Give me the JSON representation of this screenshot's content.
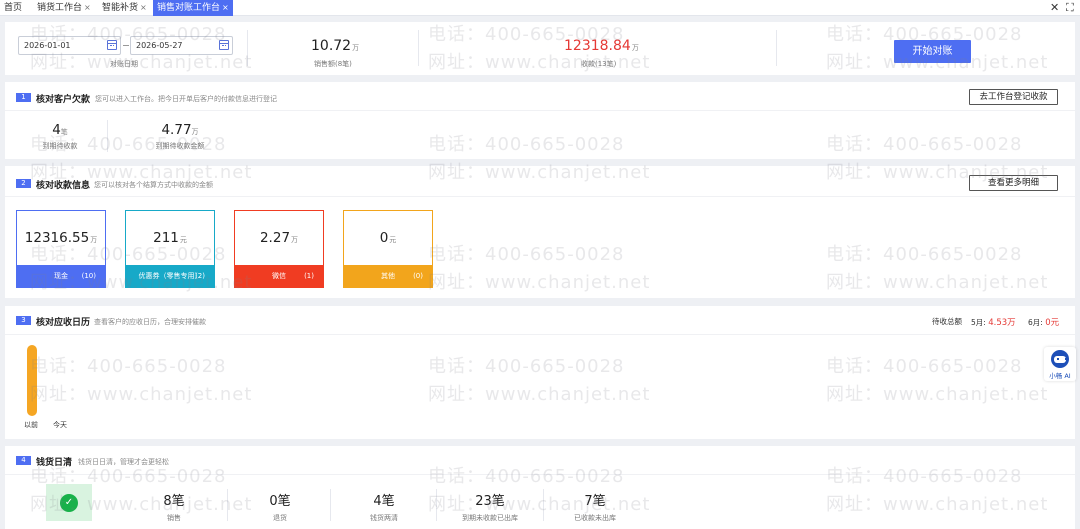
{
  "tabs": [
    {
      "label": "首页",
      "closable": false,
      "active": false
    },
    {
      "label": "销货工作台",
      "closable": true,
      "active": false
    },
    {
      "label": "智能补货",
      "closable": true,
      "active": false
    },
    {
      "label": "销售对账工作台",
      "closable": true,
      "active": true
    }
  ],
  "tab_close_glyph": "×",
  "window_controls": {
    "close": "✕",
    "fullscreen": "⛶"
  },
  "reconcile": {
    "start_date": "2026-01-01",
    "end_date": "2026-05-27",
    "date_label": "对账日期",
    "sales_amount": "10.72",
    "sales_unit": "万",
    "sales_label": "销售额(8笔)",
    "receipt_amount": "12318.84",
    "receipt_unit": "万",
    "receipt_label": "收款(13笔)",
    "start_button": "开始对账"
  },
  "section1": {
    "num": "1",
    "title": "核对客户欠款",
    "desc": "您可以进入工作台。把今日开单后客户的付款信息进行登记",
    "button": "去工作台登记收款",
    "stats": [
      {
        "value": "4",
        "unit": "笔",
        "label": "到期待收款"
      },
      {
        "value": "4.77",
        "unit": "万",
        "label": "到期待收款金额"
      }
    ]
  },
  "section2": {
    "num": "2",
    "title": "核对收款信息",
    "desc": "您可以核对各个结算方式中收款的金额",
    "button": "查看更多明细",
    "cards": [
      {
        "value": "12316.55",
        "unit": "万",
        "name": "现金",
        "count": "(10)",
        "color": "#4e6ef2"
      },
      {
        "value": "211",
        "unit": "元",
        "name": "优惠券（零售专用）",
        "count": "(2)",
        "color": "#17a9c8"
      },
      {
        "value": "2.27",
        "unit": "万",
        "name": "微信",
        "count": "(1)",
        "color": "#f03c22"
      },
      {
        "value": "0",
        "unit": "元",
        "name": "其他",
        "count": "(0)",
        "color": "#f2a51c"
      }
    ]
  },
  "section3": {
    "num": "3",
    "title": "核对应收日历",
    "desc": "查看客户的应收日历，合理安排催款",
    "total_label": "待收总额",
    "months": [
      {
        "label": "5月:",
        "amount": "4.53万"
      },
      {
        "label": "6月:",
        "amount": "0元"
      }
    ],
    "calendar_labels": [
      "以前",
      "今天"
    ]
  },
  "section4": {
    "num": "4",
    "title": "钱货日清",
    "desc": "钱货日日清，管理才会更轻松",
    "check_glyph": "✓",
    "stats": [
      {
        "value": "8笔",
        "label": "销售"
      },
      {
        "value": "0笔",
        "label": "退货"
      },
      {
        "value": "4笔",
        "label": "钱货两清"
      },
      {
        "value": "23笔",
        "label": "到期未收款已出库"
      },
      {
        "value": "7笔",
        "label": "已收款未出库"
      }
    ]
  },
  "assistant": {
    "label": "小畅 AI"
  },
  "watermark": {
    "phone": "电话：400-665-0028",
    "site": "网址：www.chanjet.net"
  }
}
